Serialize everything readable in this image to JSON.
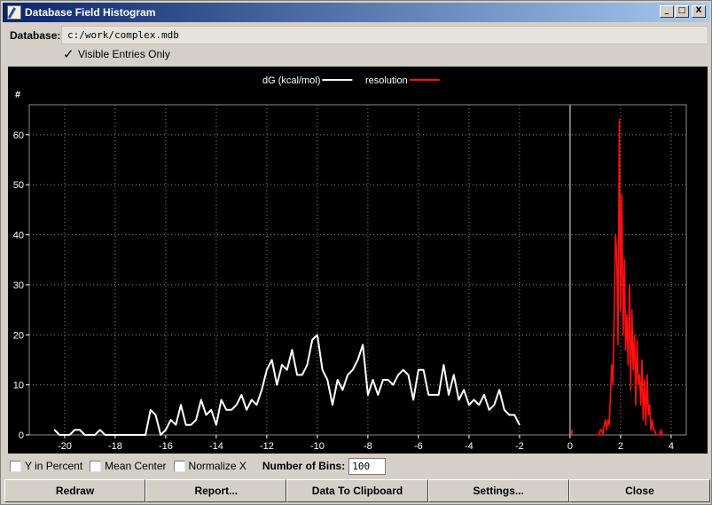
{
  "window": {
    "title": "Database Field Histogram",
    "minimize_glyph": "_",
    "maximize_glyph": "□",
    "close_glyph": "X"
  },
  "database": {
    "label": "Database:",
    "path": "c:/work/complex.mdb"
  },
  "visible_only": {
    "label": "Visible Entries Only",
    "checked": true,
    "check_glyph": "✓"
  },
  "options": {
    "y_in_percent": "Y in Percent",
    "mean_center": "Mean Center",
    "normalize_x": "Normalize X",
    "bins_label": "Number of Bins:",
    "bins_value": "100"
  },
  "buttons": {
    "redraw": "Redraw",
    "report": "Report...",
    "clipboard": "Data To Clipboard",
    "settings": "Settings...",
    "close": "Close"
  },
  "colors": {
    "plot_bg": "#000000",
    "series_dg": "#ffffff",
    "series_resolution": "#ff1010",
    "grid": "#8c8c8c",
    "zero_line": "#a0a0a0",
    "title_start": "#0a246a",
    "title_end": "#a6caf0"
  },
  "chart_data": {
    "type": "line",
    "ylabel": "#",
    "xlim": [
      -21.4,
      4.6
    ],
    "ylim": [
      0,
      66
    ],
    "xticks": [
      -20,
      -18,
      -16,
      -14,
      -12,
      -10,
      -8,
      -6,
      -4,
      -2,
      0,
      2,
      4
    ],
    "yticks": [
      0,
      10,
      20,
      30,
      40,
      50,
      60
    ],
    "grid": true,
    "legend_position": "top-center",
    "series": [
      {
        "name": "dG (kcal/mol)",
        "color": "#ffffff",
        "x": [
          -20.4,
          -20.2,
          -20.0,
          -19.8,
          -19.6,
          -19.4,
          -19.2,
          -19.0,
          -18.8,
          -18.6,
          -18.4,
          -18.2,
          -18.0,
          -17.8,
          -17.6,
          -17.4,
          -17.2,
          -17.0,
          -16.8,
          -16.6,
          -16.4,
          -16.2,
          -16.0,
          -15.8,
          -15.6,
          -15.4,
          -15.2,
          -15.0,
          -14.8,
          -14.6,
          -14.4,
          -14.2,
          -14.0,
          -13.8,
          -13.6,
          -13.4,
          -13.2,
          -13.0,
          -12.8,
          -12.6,
          -12.4,
          -12.2,
          -12.0,
          -11.8,
          -11.6,
          -11.4,
          -11.2,
          -11.0,
          -10.8,
          -10.6,
          -10.4,
          -10.2,
          -10.0,
          -9.8,
          -9.6,
          -9.4,
          -9.2,
          -9.0,
          -8.8,
          -8.6,
          -8.4,
          -8.2,
          -8.0,
          -7.8,
          -7.6,
          -7.4,
          -7.2,
          -7.0,
          -6.8,
          -6.6,
          -6.4,
          -6.2,
          -6.0,
          -5.8,
          -5.6,
          -5.4,
          -5.2,
          -5.0,
          -4.8,
          -4.6,
          -4.4,
          -4.2,
          -4.0,
          -3.8,
          -3.6,
          -3.4,
          -3.2,
          -3.0,
          -2.8,
          -2.6,
          -2.4,
          -2.2,
          -2.0
        ],
        "y": [
          1,
          0,
          0,
          0,
          1,
          1,
          0,
          0,
          0,
          1,
          0,
          0,
          0,
          0,
          0,
          0,
          0,
          0,
          0,
          5,
          4,
          0,
          1,
          3,
          2,
          6,
          2,
          2,
          3,
          7,
          4,
          5,
          2,
          7,
          5,
          5,
          6,
          8,
          5,
          7,
          6,
          9,
          13,
          15,
          10,
          14,
          13,
          17,
          12,
          12,
          14,
          19,
          20,
          13,
          11,
          6,
          11,
          9,
          12,
          13,
          15,
          18,
          8,
          11,
          8,
          11,
          11,
          10,
          12,
          13,
          12,
          7,
          13,
          13,
          8,
          8,
          8,
          14,
          8,
          12,
          7,
          9,
          6,
          7,
          6,
          8,
          5,
          6,
          9,
          5,
          4,
          4,
          2
        ],
        "range_end": [
          -2.0,
          2
        ]
      },
      {
        "name": "resolution",
        "color": "#ff1010",
        "x": [
          1.0,
          1.05,
          1.1,
          1.15,
          1.2,
          1.25,
          1.3,
          1.35,
          1.4,
          1.45,
          1.5,
          1.55,
          1.6,
          1.65,
          1.7,
          1.75,
          1.8,
          1.85,
          1.9,
          1.95,
          2.0,
          2.05,
          2.1,
          2.15,
          2.2,
          2.25,
          2.3,
          2.35,
          2.4,
          2.45,
          2.5,
          2.55,
          2.6,
          2.65,
          2.7,
          2.75,
          2.8,
          2.85,
          2.9,
          2.95,
          3.0,
          3.05,
          3.1,
          3.15,
          3.2,
          3.25,
          3.3,
          3.35,
          3.4,
          3.45,
          3.5,
          3.55,
          3.6,
          3.65
        ],
        "y": [
          0,
          0,
          0,
          0,
          1,
          1,
          0,
          2,
          3,
          1,
          3,
          2,
          8,
          14,
          10,
          25,
          40,
          36,
          18,
          63,
          25,
          48,
          20,
          35,
          17,
          24,
          14,
          30,
          9,
          25,
          13,
          20,
          6,
          19,
          10,
          12,
          6,
          15,
          3,
          11,
          2,
          12,
          4,
          6,
          1,
          3,
          1,
          1,
          0,
          0,
          0,
          0,
          1,
          0
        ]
      }
    ],
    "extra_marks": {
      "zero_mark_y": [
        0,
        1
      ]
    }
  }
}
